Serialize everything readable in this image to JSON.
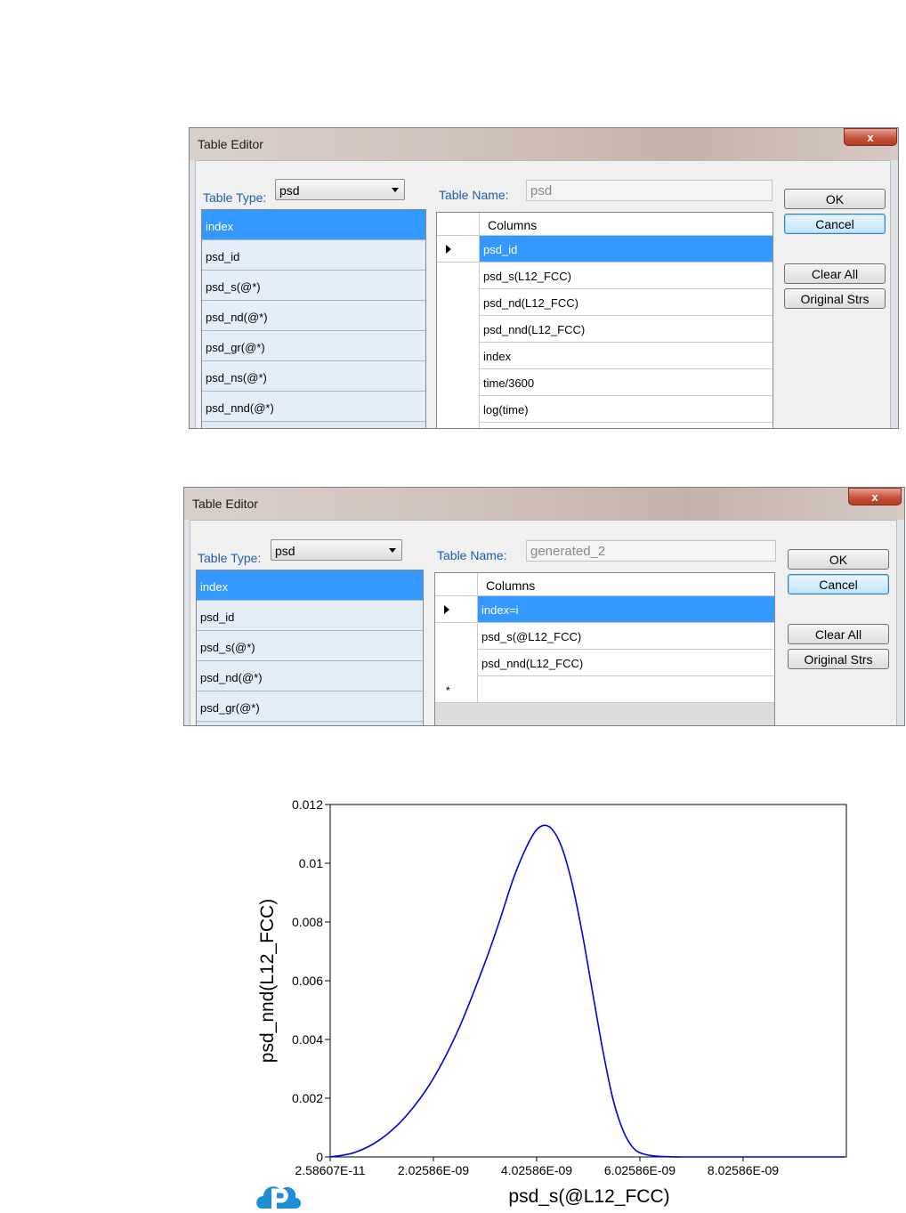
{
  "dialog1": {
    "title": "Table Editor",
    "close": "x",
    "table_type_label": "Table Type:",
    "table_type_value": "psd",
    "table_name_label": "Table Name:",
    "table_name_value": "psd",
    "list_items": [
      "index",
      "psd_id",
      "psd_s(@*)",
      "psd_nd(@*)",
      "psd_gr(@*)",
      "psd_ns(@*)",
      "psd_nnd(@*)"
    ],
    "columns_header": "Columns",
    "columns": [
      "psd_id",
      "psd_s(L12_FCC)",
      "psd_nd(L12_FCC)",
      "psd_nnd(L12_FCC)",
      "index",
      "time/3600",
      "log(time)"
    ],
    "buttons": {
      "ok": "OK",
      "cancel": "Cancel",
      "clear_all": "Clear All",
      "original": "Original Strs"
    }
  },
  "dialog2": {
    "title": "Table Editor",
    "close": "x",
    "table_type_label": "Table Type:",
    "table_type_value": "psd",
    "table_name_label": "Table Name:",
    "table_name_value": "generated_2",
    "list_items": [
      "index",
      "psd_id",
      "psd_s(@*)",
      "psd_nd(@*)",
      "psd_gr(@*)"
    ],
    "columns_header": "Columns",
    "columns": [
      "index=i",
      "psd_s(@L12_FCC)",
      "psd_nnd(L12_FCC)"
    ],
    "new_row_marker": "*",
    "buttons": {
      "ok": "OK",
      "cancel": "Cancel",
      "clear_all": "Clear All",
      "original": "Original Strs"
    }
  },
  "chart_data": {
    "type": "line",
    "xlabel": "psd_s(@L12_FCC)",
    "ylabel": "psd_nnd(L12_FCC)",
    "xlim": [
      2.58607e-11,
      1.002586e-08
    ],
    "ylim": [
      0,
      0.012
    ],
    "x_ticks": [
      "2.58607E-11",
      "2.02586E-09",
      "4.02586E-09",
      "6.02586E-09",
      "8.02586E-09"
    ],
    "y_ticks": [
      "0",
      "0.002",
      "0.004",
      "0.006",
      "0.008",
      "0.01",
      "0.012"
    ],
    "series": [
      {
        "color": "#0000dd",
        "x": [
          2.58607e-11,
          5e-10,
          1e-09,
          1.5e-09,
          2e-09,
          2.5e-09,
          3e-09,
          3.3e-09,
          3.6e-09,
          3.9e-09,
          4.1e-09,
          4.3e-09,
          4.5e-09,
          4.7e-09,
          4.9e-09,
          5.1e-09,
          5.3e-09,
          5.5e-09,
          5.7e-09,
          5.9e-09,
          6.1e-09,
          6.4e-09,
          6.8e-09,
          7.5e-09,
          8.5e-09,
          1e-08
        ],
        "y": [
          0,
          0.00015,
          0.0006,
          0.0014,
          0.0026,
          0.0043,
          0.0065,
          0.008,
          0.0096,
          0.0108,
          0.01125,
          0.0112,
          0.0106,
          0.0094,
          0.0077,
          0.0057,
          0.0037,
          0.002,
          0.0009,
          0.0003,
          0.0001,
          2e-05,
          0,
          0,
          0,
          0
        ]
      }
    ]
  },
  "logo_icon": "cloud-p-logo-icon"
}
